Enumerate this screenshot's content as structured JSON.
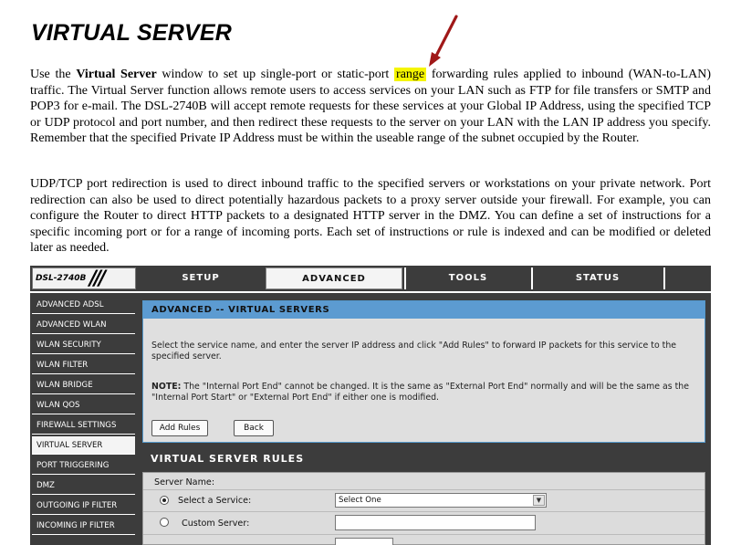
{
  "doc": {
    "title": "VIRTUAL SERVER",
    "p1_a": "Use the ",
    "p1_b": "Virtual Server",
    "p1_c": " window to set up single-port or static-port ",
    "p1_highlight": "range",
    "p1_d": " forwarding rules applied to inbound (WAN-to-LAN) traffic. The Virtual Server function allows remote users to access services on your LAN such as FTP for file transfers or SMTP and POP3 for e-mail. The DSL-2740B will accept remote requests for these services at your Global IP Address, using the specified TCP or UDP protocol and port number, and then redirect these requests to the server on your LAN with the LAN IP address you specify. Remember that the specified Private IP Address must be within the useable range of the subnet occupied by the Router.",
    "p2": "UDP/TCP port redirection is used to direct inbound traffic to the specified servers or workstations on your private network. Port redirection can also be used to direct potentially hazardous packets to a proxy server outside your firewall. For example, you can configure the Router to direct HTTP packets to a designated HTTP server in the DMZ. You can define a set of instructions for a specific incoming port or for a range of incoming ports. Each set of instructions or rule is indexed and can be modified or deleted later as needed."
  },
  "router": {
    "model": "DSL-2740B",
    "tabs": [
      {
        "label": "SETUP"
      },
      {
        "label": "ADVANCED"
      },
      {
        "label": "TOOLS"
      },
      {
        "label": "STATUS"
      }
    ],
    "sidebar": [
      {
        "label": "ADVANCED ADSL"
      },
      {
        "label": "ADVANCED WLAN"
      },
      {
        "label": "WLAN SECURITY"
      },
      {
        "label": "WLAN FILTER"
      },
      {
        "label": "WLAN BRIDGE"
      },
      {
        "label": "WLAN QOS"
      },
      {
        "label": "FIREWALL SETTINGS"
      },
      {
        "label": "VIRTUAL SERVER"
      },
      {
        "label": "PORT TRIGGERING"
      },
      {
        "label": "DMZ"
      },
      {
        "label": "OUTGOING IP FILTER"
      },
      {
        "label": "INCOMING IP FILTER"
      }
    ],
    "panel1": {
      "title": "ADVANCED -- VIRTUAL SERVERS",
      "intro": "Select the service name, and enter the server IP address and click \"Add Rules\" to forward IP packets for this service to the specified server.",
      "note_label": "NOTE:",
      "note": " The \"Internal Port End\" cannot be changed. It is the same as \"External Port End\" normally and will be the same as the \"Internal Port Start\" or \"External Port End\" if either one is modified.",
      "add_rules": "Add Rules",
      "back": "Back"
    },
    "panel2": {
      "title": "VIRTUAL SERVER RULES",
      "server_name_label": "Server Name:",
      "select_service_label": "Select a Service:",
      "select_value": "Select One",
      "custom_server_label": "Custom Server:"
    }
  }
}
